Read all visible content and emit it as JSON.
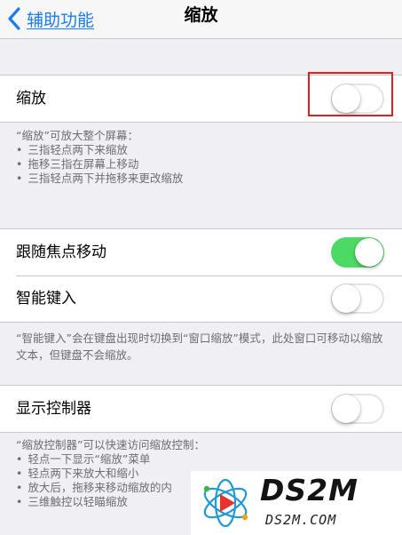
{
  "navbar": {
    "back_label": "辅助功能",
    "title": "缩放"
  },
  "zoom_section": {
    "label": "缩放",
    "switch_on": false,
    "footer_title": "“缩放”可放大整个屏幕：",
    "footer_items": [
      "三指轻点两下来缩放",
      "拖移三指在屏幕上移动",
      "三指轻点两下并拖移来更改缩放"
    ]
  },
  "focus_section": {
    "follow_focus": {
      "label": "跟随焦点移动",
      "switch_on": true
    },
    "smart_typing": {
      "label": "智能键入",
      "switch_on": false
    },
    "footer_text": "“智能键入”会在键盘出现时切换到“窗口缩放”模式，此处窗口可移动以缩放文本，但键盘不会缩放。"
  },
  "controller_section": {
    "label": "显示控制器",
    "switch_on": false,
    "footer_title": "“缩放控制器”可以快速访问缩放控制：",
    "footer_items": [
      "轻点一下显示“缩放”菜单",
      "轻点两下来放大和缩小",
      "放大后，拖移来移动缩放的内",
      "三维触控以轻瞄缩放"
    ]
  },
  "watermark": {
    "title": "DS2M",
    "subtitle": "DS2M.COM"
  },
  "colors": {
    "switch_on": "#4cd964",
    "link_blue": "#1a7cf2",
    "highlight_red": "#e02020",
    "background": "#efeff4"
  }
}
